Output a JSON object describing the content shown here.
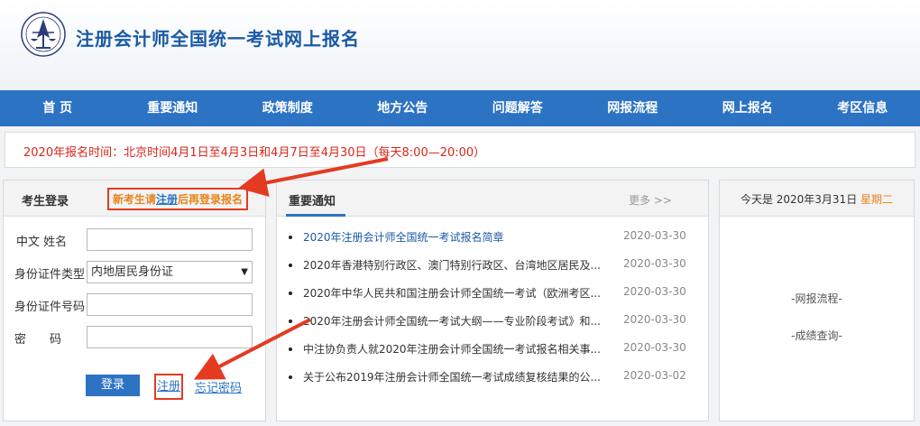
{
  "header": {
    "site_title": "注册会计师全国统一考试网上报名"
  },
  "nav": {
    "items": [
      "首 页",
      "重要通知",
      "政策制度",
      "地方公告",
      "问题解答",
      "网报流程",
      "网上报名",
      "考区信息"
    ]
  },
  "notice": {
    "text": "2020年报名时间：北京时间4月1日至4月3日和4月7日至4月30日（每天8:00—20:00）"
  },
  "login": {
    "title": "考生登录",
    "register_tip_prefix": "新考生请",
    "register_tip_link": "注册",
    "register_tip_suffix": "后再登录报名",
    "fields": {
      "name_label": "中文 姓名",
      "id_type_label": "身份证件类型",
      "id_type_value": "内地居民身份证",
      "id_number_label": "身份证件号码",
      "password_label": "密　　码"
    },
    "login_button": "登录",
    "register_link": "注册",
    "forgot_link": "忘记密码"
  },
  "news": {
    "title": "重要通知",
    "more": "更多 >>",
    "items": [
      {
        "title": "2020年注册会计师全国统一考试报名简章",
        "date": "2020-03-30"
      },
      {
        "title": "2020年香港特别行政区、澳门特别行政区、台湾地区居民及...",
        "date": "2020-03-30"
      },
      {
        "title": "2020年中华人民共和国注册会计师全国统一考试（欧洲考区...",
        "date": "2020-03-30"
      },
      {
        "title": "2020年注册会计师全国统一考试大纲——专业阶段考试》和...",
        "date": "2020-03-30"
      },
      {
        "title": "中注协负责人就2020年注册会计师全国统一考试报名相关事...",
        "date": "2020-03-30"
      },
      {
        "title": "关于公布2019年注册会计师全国统一考试成绩复核结果的公...",
        "date": "2020-03-02"
      }
    ]
  },
  "today": {
    "prefix": "今天是 2020年3月31日",
    "weekday": "星期二",
    "links": [
      "-网报流程-",
      "-成绩查询-"
    ]
  },
  "colors": {
    "nav_bg": "#2d73c4",
    "accent_red": "#d9261c",
    "highlight_orange": "#e8831b",
    "annotation_red": "#e33b21"
  },
  "icons": {
    "logo": "cicpa-emblem-icon",
    "select_arrow": "chevron-down-icon",
    "bullet": "bullet-dot-icon"
  }
}
